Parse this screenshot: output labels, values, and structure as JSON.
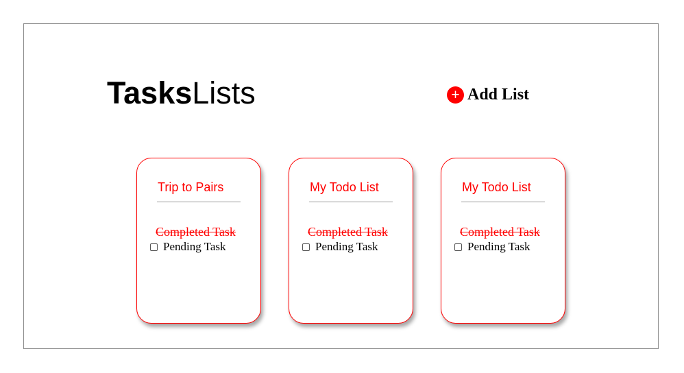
{
  "header": {
    "brand_bold": "Tasks",
    "brand_light": "Lists",
    "add_list_icon": "+",
    "add_list_label": "Add List"
  },
  "colors": {
    "accent": "#ff0000",
    "text": "#000000",
    "divider": "#9a9a9a"
  },
  "lists": [
    {
      "title": "Trip to Pairs",
      "completed_task": "Completed Task",
      "pending_task": "Pending Task",
      "pending_checked": false
    },
    {
      "title": "My Todo List",
      "completed_task": "Completed Task",
      "pending_task": "Pending Task",
      "pending_checked": false
    },
    {
      "title": "My Todo List",
      "completed_task": "Completed Task",
      "pending_task": "Pending Task",
      "pending_checked": false
    }
  ]
}
